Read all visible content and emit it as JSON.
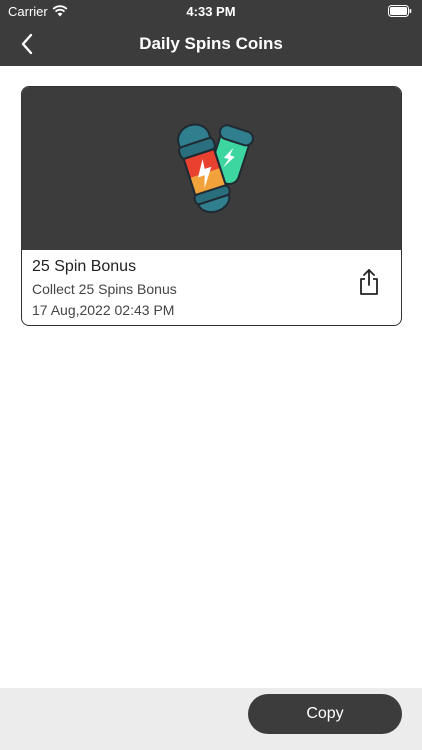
{
  "status_bar": {
    "carrier": "Carrier",
    "time": "4:33 PM",
    "wifi_icon": "wifi-icon",
    "battery_icon": "battery-icon"
  },
  "nav": {
    "back_icon": "chevron-left-icon",
    "title": "Daily Spins Coins"
  },
  "card": {
    "image_icon": "spin-capsule-icon",
    "title": "25 Spin Bonus",
    "subtitle": "Collect 25 Spins Bonus",
    "date": "17 Aug,2022 02:43 PM",
    "share_icon": "share-icon"
  },
  "footer": {
    "copy_label": "Copy"
  },
  "colors": {
    "bar_background": "#3c3c3c",
    "bottom_bar_background": "#ececec",
    "capsule_teal": "#2f7f8f",
    "capsule_red": "#e8412f",
    "capsule_orange": "#f2a23a",
    "capsule_green": "#3ed6a0"
  }
}
